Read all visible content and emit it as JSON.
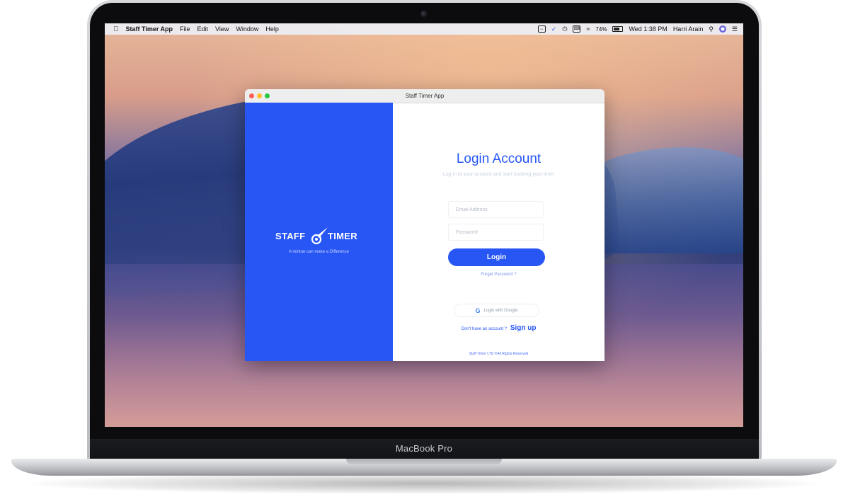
{
  "device": {
    "brand_label": "MacBook Pro"
  },
  "menubar": {
    "app_name": "Staff Timer App",
    "menus": [
      "File",
      "Edit",
      "View",
      "Window",
      "Help"
    ],
    "battery_percent": "74%",
    "datetime": "Wed 1:38 PM",
    "user_name": "Harri Arain"
  },
  "window": {
    "title": "Staff Timer App"
  },
  "brand": {
    "logo_left": "STAFF",
    "logo_right": "TIMER",
    "tagline": "A mintue can make a Difference"
  },
  "login": {
    "title": "Login Account",
    "subtitle": "Log in to your account and start tracking your time!",
    "email_placeholder": "Email Address",
    "password_placeholder": "Password",
    "login_button": "Login",
    "forgot_password": "Forget Password ?",
    "google_button": "Login with Google",
    "no_account_text": "Don't have an account ?",
    "signup_link": "Sign up",
    "footer": "Staff Timer LTD ©All Rights Reserved"
  },
  "colors": {
    "brand_blue": "#2756f5",
    "close": "#fe5f57",
    "minimize": "#febc2e",
    "zoom": "#28c840"
  }
}
